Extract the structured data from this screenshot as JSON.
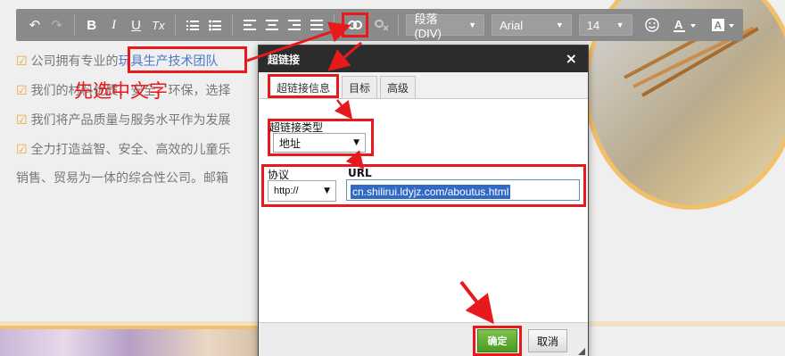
{
  "toolbar": {
    "buttons": [
      "↶",
      "↷",
      "B",
      "I",
      "U",
      "Tx"
    ],
    "paragraph_select": "段落(DIV)",
    "font_select": "Arial",
    "size_select": "14"
  },
  "content": {
    "line1_prefix": "公司拥有专业的",
    "line1_highlight": "玩具生产技术团队",
    "line2": "我们的材料优质、安全、环保，选择",
    "line3": "我们将产品质量与服务水平作为发展",
    "line4": "全力打造益智、安全、高效的儿童乐",
    "line5": "销售、贸易为一体的综合性公司。邮箱"
  },
  "annotation": "先选中文字",
  "dialog": {
    "title": "超链接",
    "close": "×",
    "tabs": [
      "超链接信息",
      "目标",
      "高级"
    ],
    "link_type_label": "超链接类型",
    "link_type_value": "地址",
    "protocol_label": "协议",
    "protocol_value": "http://",
    "url_label": "URL",
    "url_value": "cn.shilirui.ldyjz.com/aboutus.html",
    "ok_label": "确定",
    "cancel_label": "取消"
  },
  "colors": {
    "annotation_red": "#e8191c",
    "toolbar_gray": "#8a8a8a",
    "ok_green": "#5aab2e",
    "selection_blue": "#3169c6"
  }
}
